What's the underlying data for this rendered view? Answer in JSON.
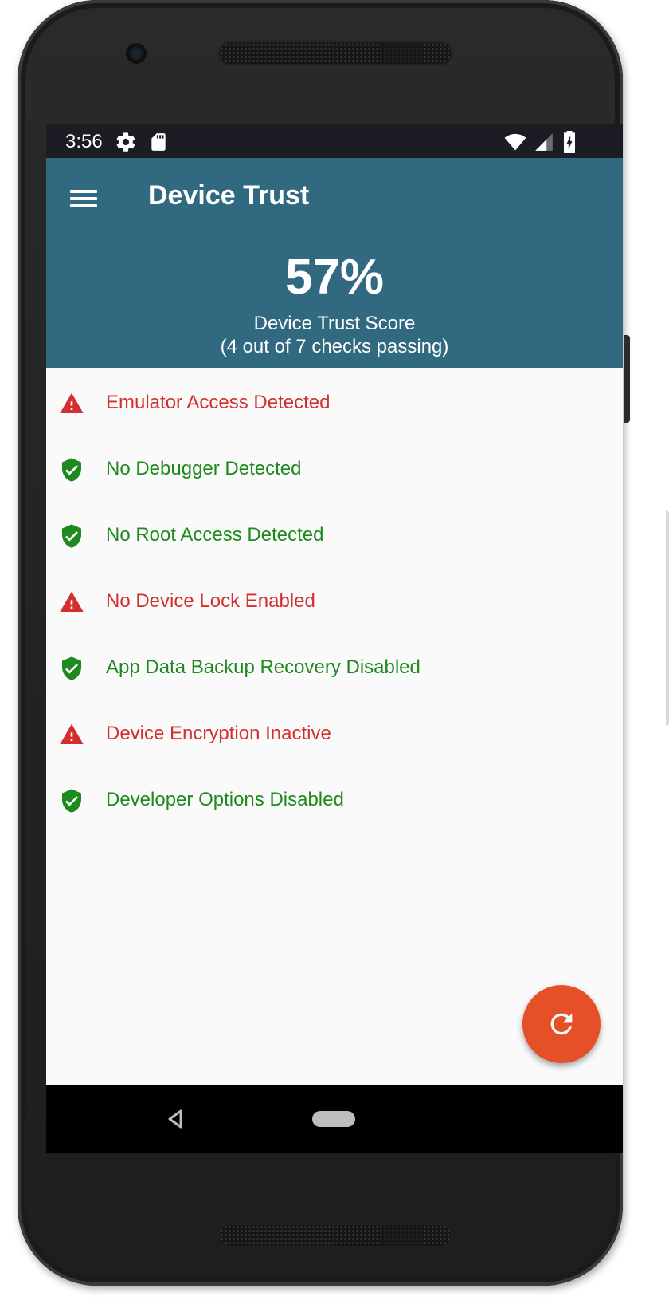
{
  "status_bar": {
    "time": "3:56",
    "icons": [
      "settings-icon",
      "sd-card-icon",
      "wifi-icon",
      "signal-icon",
      "battery-charging-icon"
    ]
  },
  "app_bar": {
    "menu_icon": "hamburger-menu-icon",
    "title": "Device Trust"
  },
  "score": {
    "value": "57%",
    "label": "Device Trust Score",
    "summary": "(4 out of 7 checks passing)"
  },
  "checks": [
    {
      "label": "Emulator Access Detected",
      "status": "fail",
      "icon": "warning-icon"
    },
    {
      "label": "No Debugger Detected",
      "status": "pass",
      "icon": "shield-check-icon"
    },
    {
      "label": "No Root Access Detected",
      "status": "pass",
      "icon": "shield-check-icon"
    },
    {
      "label": "No Device Lock Enabled",
      "status": "fail",
      "icon": "warning-icon"
    },
    {
      "label": "App Data Backup Recovery Disabled",
      "status": "pass",
      "icon": "shield-check-icon"
    },
    {
      "label": "Device Encryption Inactive",
      "status": "fail",
      "icon": "warning-icon"
    },
    {
      "label": "Developer Options Disabled",
      "status": "pass",
      "icon": "shield-check-icon"
    }
  ],
  "fab": {
    "icon": "refresh-icon"
  },
  "nav_bar": {
    "icons": [
      "back-icon",
      "home-icon"
    ]
  },
  "colors": {
    "primary": "#316a80",
    "status_bar": "#1c1c24",
    "fail": "#d32f2f",
    "pass": "#1e8a1e",
    "accent": "#e65028"
  }
}
